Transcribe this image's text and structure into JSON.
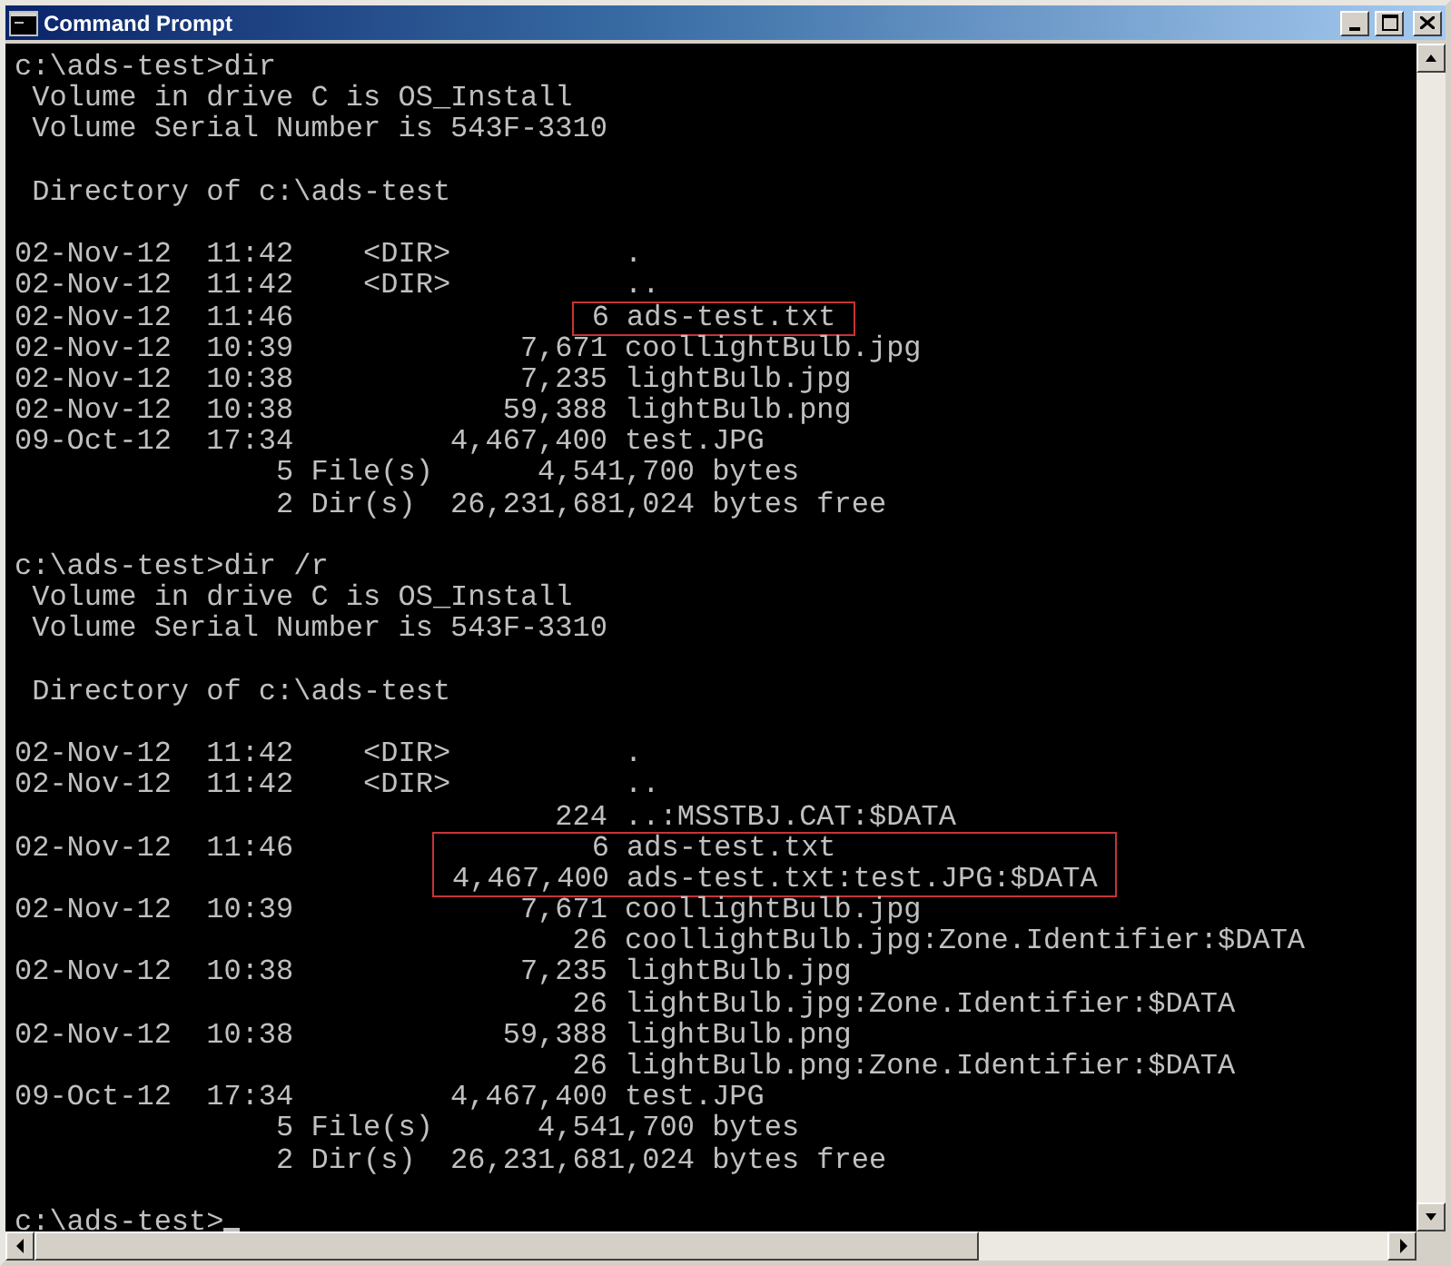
{
  "window": {
    "title": "Command Prompt"
  },
  "console": {
    "lines": [
      {
        "kind": "text",
        "text": "c:\\ads-test>dir"
      },
      {
        "kind": "text",
        "text": " Volume in drive C is OS_Install"
      },
      {
        "kind": "text",
        "text": " Volume Serial Number is 543F-3310"
      },
      {
        "kind": "blank"
      },
      {
        "kind": "text",
        "text": " Directory of c:\\ads-test"
      },
      {
        "kind": "blank"
      },
      {
        "kind": "text",
        "text": "02-Nov-12  11:42    <DIR>          ."
      },
      {
        "kind": "text",
        "text": "02-Nov-12  11:42    <DIR>          .."
      },
      {
        "kind": "marked",
        "rows": [
          {
            "lead": "02-Nov-12  11:46                ",
            "boxed": " 6 ads-test.txt "
          }
        ]
      },
      {
        "kind": "text",
        "text": "02-Nov-12  10:39             7,671 coollightBulb.jpg"
      },
      {
        "kind": "text",
        "text": "02-Nov-12  10:38             7,235 lightBulb.jpg"
      },
      {
        "kind": "text",
        "text": "02-Nov-12  10:38            59,388 lightBulb.png"
      },
      {
        "kind": "text",
        "text": "09-Oct-12  17:34         4,467,400 test.JPG"
      },
      {
        "kind": "text",
        "text": "               5 File(s)      4,541,700 bytes"
      },
      {
        "kind": "text",
        "text": "               2 Dir(s)  26,231,681,024 bytes free"
      },
      {
        "kind": "blank"
      },
      {
        "kind": "text",
        "text": "c:\\ads-test>dir /r"
      },
      {
        "kind": "text",
        "text": " Volume in drive C is OS_Install"
      },
      {
        "kind": "text",
        "text": " Volume Serial Number is 543F-3310"
      },
      {
        "kind": "blank"
      },
      {
        "kind": "text",
        "text": " Directory of c:\\ads-test"
      },
      {
        "kind": "blank"
      },
      {
        "kind": "text",
        "text": "02-Nov-12  11:42    <DIR>          ."
      },
      {
        "kind": "text",
        "text": "02-Nov-12  11:42    <DIR>          .."
      },
      {
        "kind": "text",
        "text": "                               224 ..:MSSTBJ.CAT:$DATA"
      },
      {
        "kind": "marked",
        "rows": [
          {
            "lead": "02-Nov-12  11:46        ",
            "boxed": "         6 ads-test.txt"
          },
          {
            "boxed": " 4,467,400 ads-test.txt:test.JPG:$DATA "
          }
        ]
      },
      {
        "kind": "text",
        "text": "02-Nov-12  10:39             7,671 coollightBulb.jpg"
      },
      {
        "kind": "text",
        "text": "                                26 coollightBulb.jpg:Zone.Identifier:$DATA"
      },
      {
        "kind": "text",
        "text": "02-Nov-12  10:38             7,235 lightBulb.jpg"
      },
      {
        "kind": "text",
        "text": "                                26 lightBulb.jpg:Zone.Identifier:$DATA"
      },
      {
        "kind": "text",
        "text": "02-Nov-12  10:38            59,388 lightBulb.png"
      },
      {
        "kind": "text",
        "text": "                                26 lightBulb.png:Zone.Identifier:$DATA"
      },
      {
        "kind": "text",
        "text": "09-Oct-12  17:34         4,467,400 test.JPG"
      },
      {
        "kind": "text",
        "text": "               5 File(s)      4,541,700 bytes"
      },
      {
        "kind": "text",
        "text": "               2 Dir(s)  26,231,681,024 bytes free"
      },
      {
        "kind": "blank"
      },
      {
        "kind": "text",
        "text": "c:\\ads-test>",
        "cursor": true
      }
    ]
  }
}
